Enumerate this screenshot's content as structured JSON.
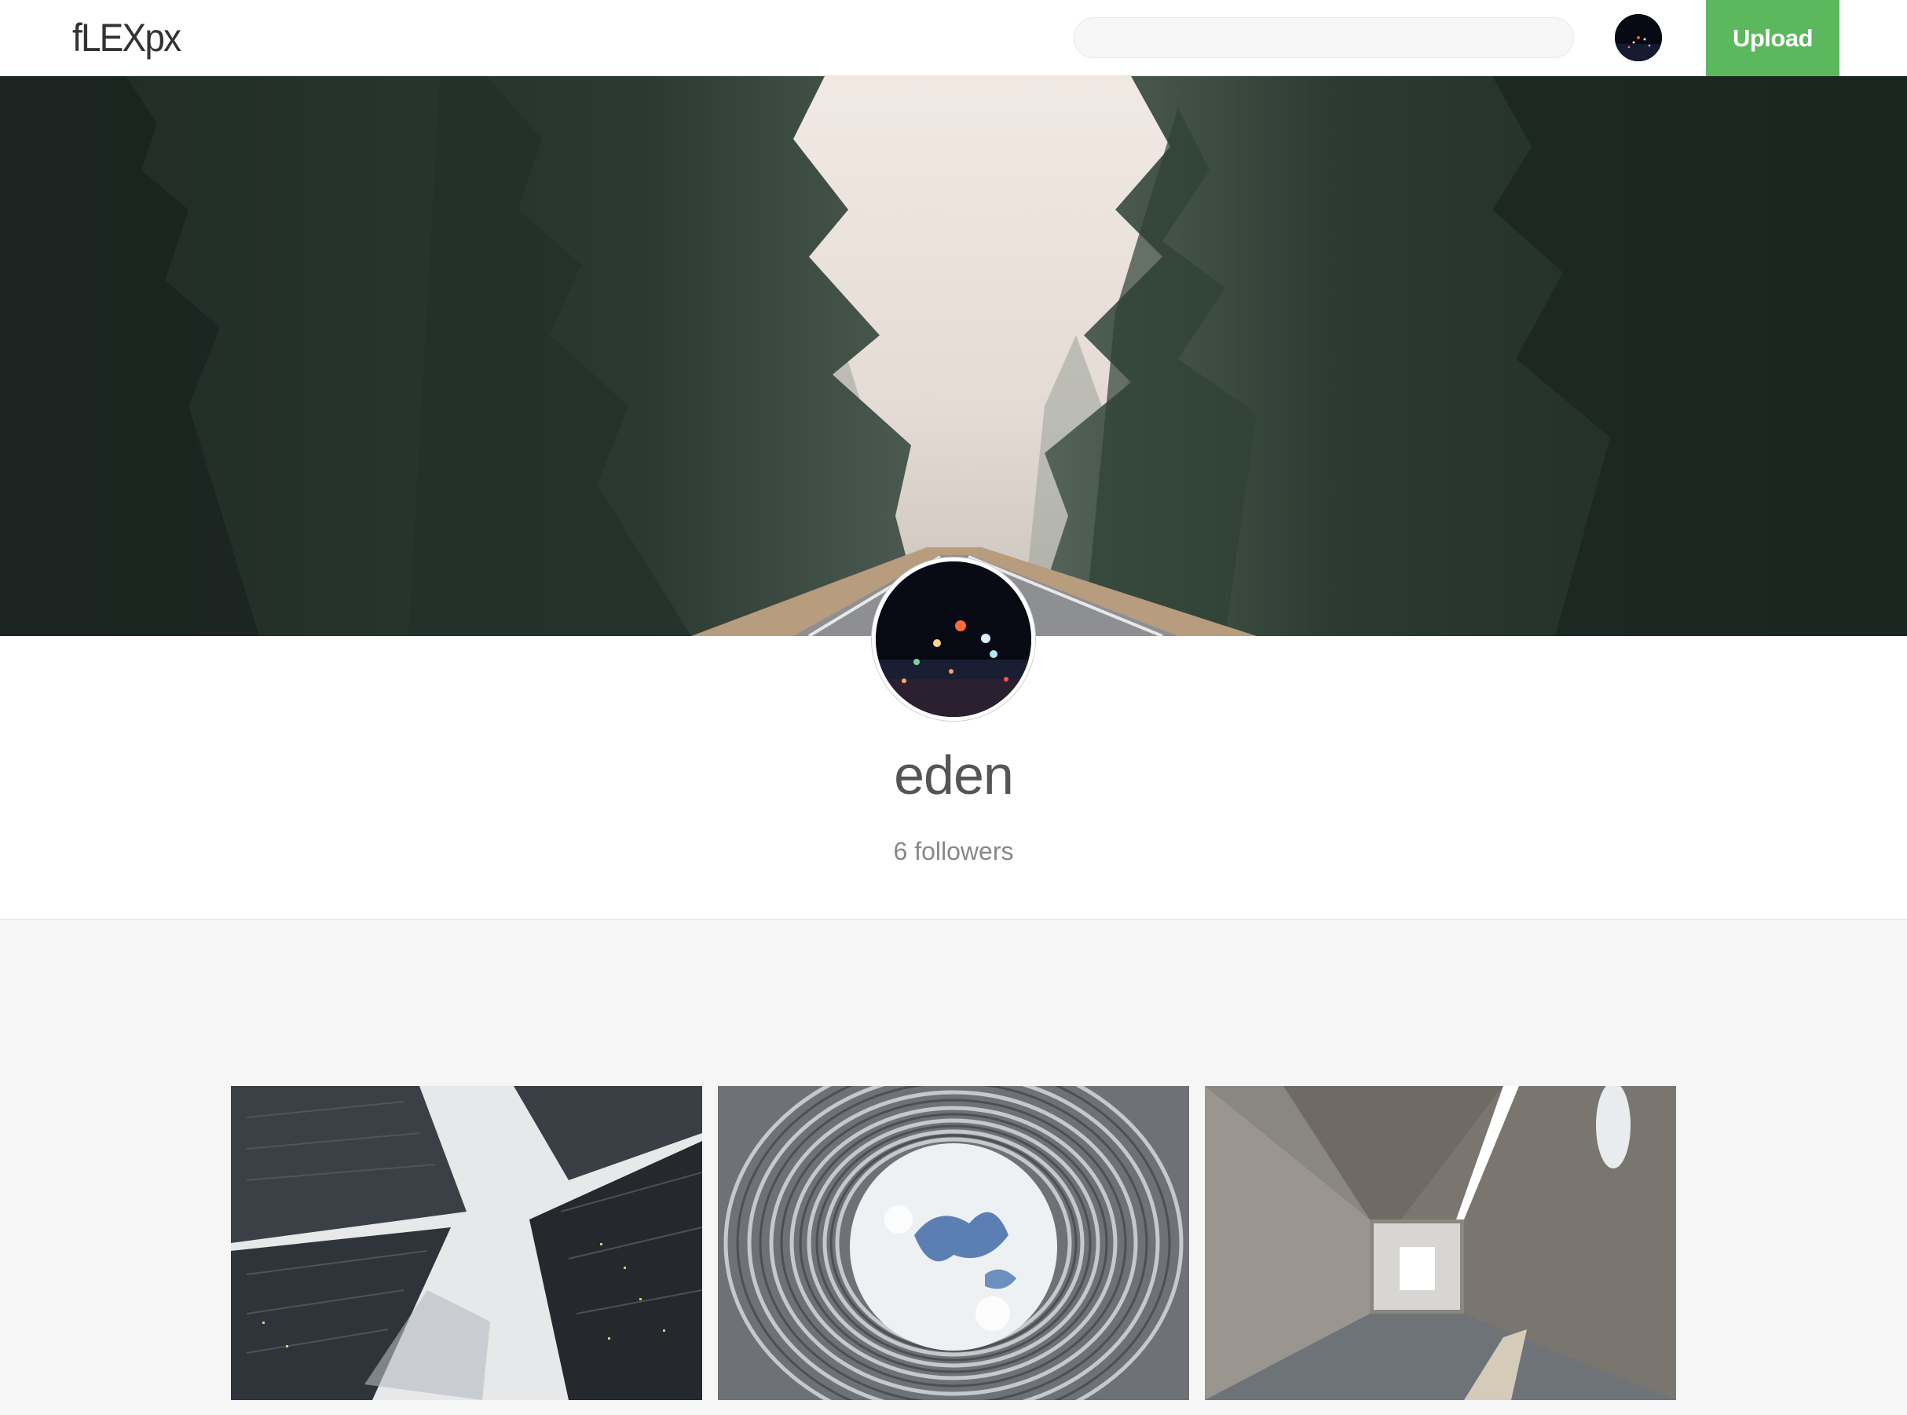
{
  "app": {
    "logo_text": "fLEXpx"
  },
  "header": {
    "search": {
      "value": "",
      "placeholder": ""
    },
    "upload_label": "Upload"
  },
  "profile": {
    "username": "eden",
    "followers_text": "6 followers"
  },
  "colors": {
    "accent": "#5cb85c",
    "page_bg": "#f6f6f6",
    "username": "#555555",
    "followers": "#888888"
  },
  "photos": [
    {
      "subject": "skyscrapers-looking-up-in-fog"
    },
    {
      "subject": "woven-facade-oculus-with-clouds"
    },
    {
      "subject": "concrete-corridor-with-light"
    }
  ],
  "icons": {
    "nav_avatar": "user-avatar-night-lights",
    "profile_avatar": "user-avatar-night-lights"
  }
}
